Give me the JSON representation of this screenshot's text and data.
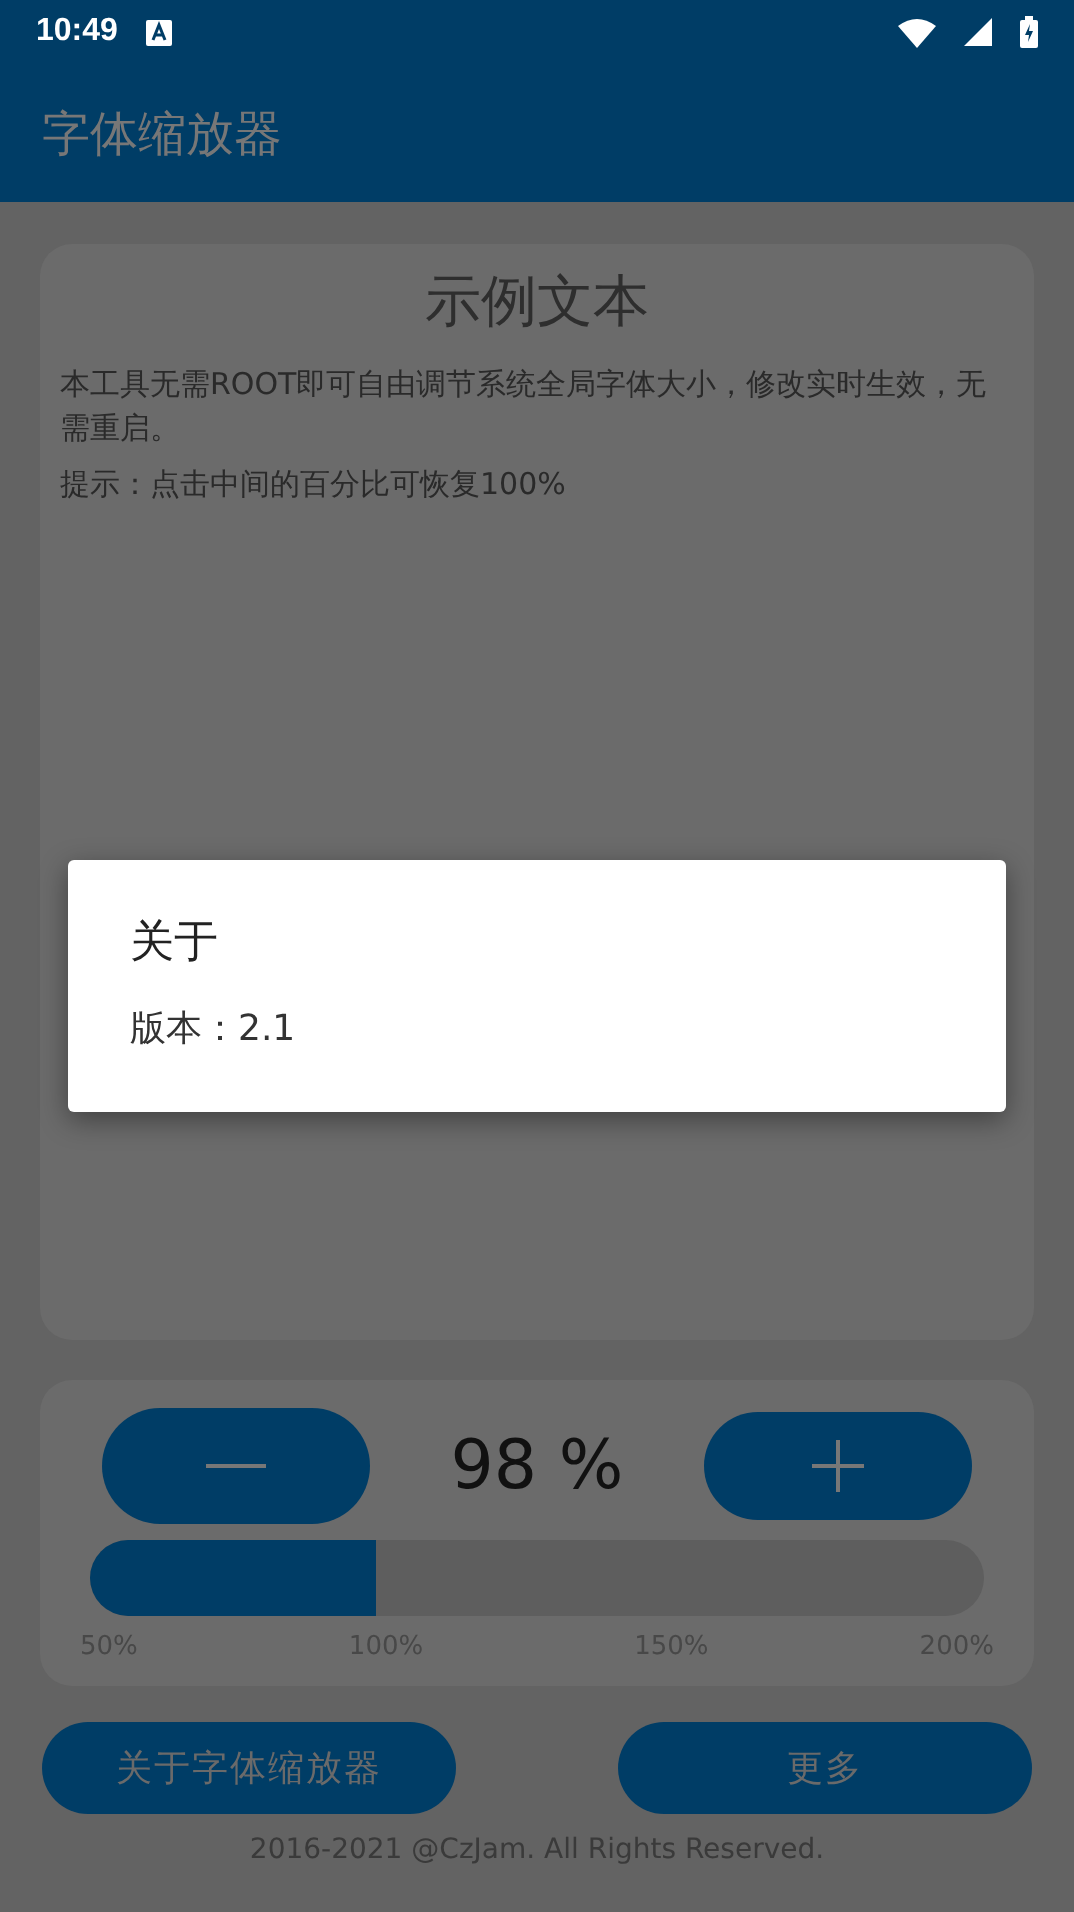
{
  "status_bar": {
    "time": "10:49"
  },
  "app_bar": {
    "title": "字体缩放器"
  },
  "sample_card": {
    "title": "示例文本",
    "paragraphs": [
      "本工具无需ROOT即可自由调节系统全局字体大小，修改实时生效，无需重启。",
      "提示：点击中间的百分比可恢复100%"
    ]
  },
  "scale_card": {
    "reading": "98 %",
    "level": 0.32,
    "ticks": [
      "50%",
      "100%",
      "150%",
      "200%"
    ]
  },
  "buttons": [
    "关于字体缩放器",
    "更多"
  ],
  "footer": "2016-2021 @CzJam. All Rights Reserved.",
  "dialog": {
    "title": "关于",
    "message": "版本：2.1"
  }
}
